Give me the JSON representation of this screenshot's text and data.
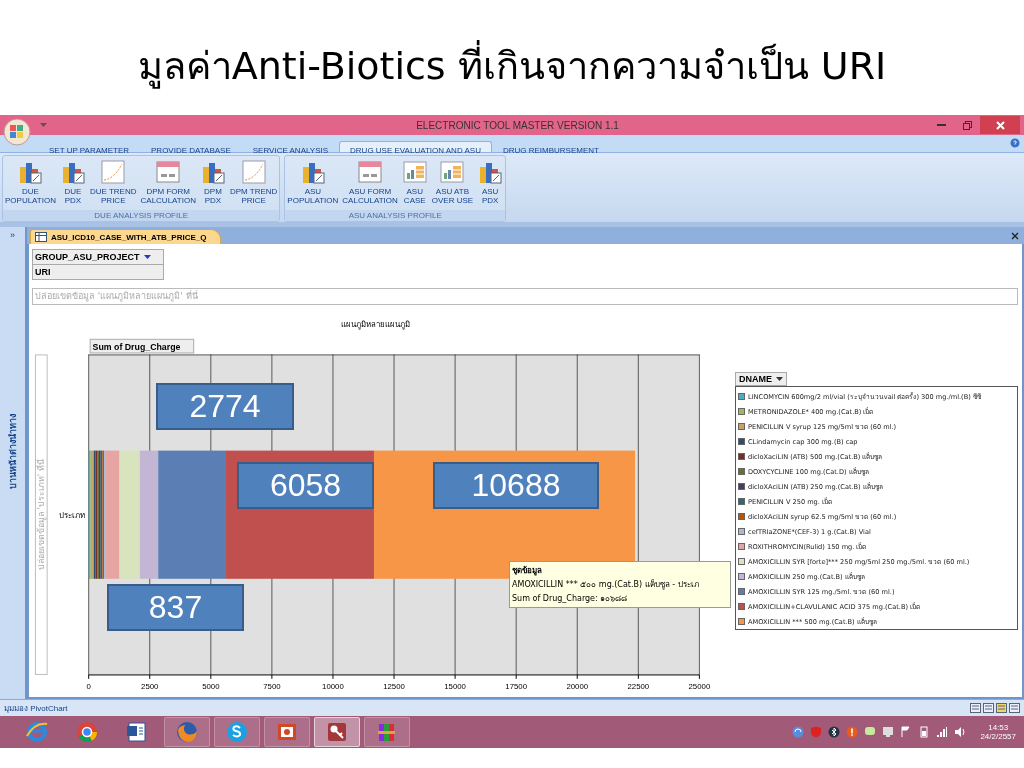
{
  "slide_title": "มูลค่าAnti-Biotics ที่เกินจากความจำเป็น URI",
  "window": {
    "title": "ELECTRONIC TOOL MASTER VERSION 1.1"
  },
  "ribbon_tabs": [
    {
      "label": "SET UP PARAMETER",
      "selected": false
    },
    {
      "label": "PROVIDE DATABASE",
      "selected": false
    },
    {
      "label": "SERVICE ANALYSIS",
      "selected": false
    },
    {
      "label": "DRUG USE EVALUATION AND ASU",
      "selected": true
    },
    {
      "label": "DRUG REIMBURSEMENT",
      "selected": false
    }
  ],
  "ribbon_groups": [
    {
      "label": "DUE ANALYSIS PROFILE",
      "buttons": [
        {
          "kind": "bars",
          "lines": [
            "DUE",
            "POPULATION"
          ]
        },
        {
          "kind": "bars",
          "lines": [
            "DUE",
            "PDX"
          ]
        },
        {
          "kind": "trend",
          "lines": [
            "DUE TREND",
            "PRICE"
          ]
        },
        {
          "kind": "form",
          "lines": [
            "DPM FORM",
            "CALCULATION"
          ]
        },
        {
          "kind": "bars",
          "lines": [
            "DPM",
            "PDX"
          ]
        },
        {
          "kind": "trend",
          "lines": [
            "DPM TREND",
            "PRICE"
          ]
        }
      ]
    },
    {
      "label": "ASU ANALYSIS PROFILE",
      "buttons": [
        {
          "kind": "bars",
          "lines": [
            "ASU",
            "POPULATION"
          ]
        },
        {
          "kind": "form",
          "lines": [
            "ASU FORM",
            "CALCULATION"
          ]
        },
        {
          "kind": "case",
          "lines": [
            "ASU",
            "CASE"
          ]
        },
        {
          "kind": "case",
          "lines": [
            "ASU ATB",
            "OVER USE"
          ]
        },
        {
          "kind": "bars",
          "lines": [
            "ASU",
            "PDX"
          ]
        }
      ]
    }
  ],
  "nav_pane": {
    "toggle": "»",
    "label": "บานหน้าต่างนำทาง"
  },
  "document_tab": {
    "title": "ASU_ICD10_CASE_WITH_ATB_PRICE_Q"
  },
  "filter": {
    "field": "GROUP_ASU_PROJECT",
    "value": "URI"
  },
  "chart_drop_zone": "ปล่อยเขตข้อมูล 'แผนภูมิหลายแผนภูมิ' ที่นี่",
  "category_drop_zone": "ปล่อยเขตข้อมูล 'ประเภท' ที่นี่",
  "data_field": "Sum of Drug_Charge",
  "legend_title": "DNAME",
  "chart_data": {
    "type": "bar",
    "orientation": "horizontal",
    "stacked": true,
    "grid": true,
    "legend": "right",
    "title": "แผนภูมิหลายแผนภูมิ",
    "categories": [
      "ประเภท"
    ],
    "xlim": [
      0,
      25000
    ],
    "xticks": [
      0,
      2500,
      5000,
      7500,
      10000,
      12500,
      15000,
      17500,
      20000,
      22500,
      25000
    ],
    "series": [
      {
        "name": "LINCOMYCIN  600mg/2 ml/vial (ระบุจำนวนvail ต่อครั้ง) 300 mg./ml.(B) ซีซี",
        "color": "#4bacc6",
        "values": [
          70
        ]
      },
      {
        "name": "METRONIDAZOLE* 400 mg.(Cat.B) เม็ด",
        "color": "#9bbb59",
        "values": [
          70
        ]
      },
      {
        "name": "PENICILLIN V syrup 125 mg/5ml ขวด (60 ml.)",
        "color": "#c8a060",
        "values": [
          70
        ]
      },
      {
        "name": "CLindamycin cap 300 mg.(B) cap",
        "color": "#2c4d75",
        "values": [
          70
        ]
      },
      {
        "name": "dicloXaciLIN (ATB) 500 mg.(Cat.B) แค็บซูล",
        "color": "#772c2a",
        "values": [
          70
        ]
      },
      {
        "name": "DOXYCYCLINE 100 mg.(Cat.D) แค็บซูล",
        "color": "#5f7530",
        "values": [
          70
        ]
      },
      {
        "name": "dicloXAciLIN (ATB) 250 mg.(Cat.B) แค็บซูล",
        "color": "#4d3b62",
        "values": [
          70
        ]
      },
      {
        "name": "PENICILLIN  V 250 mg. เม็ด",
        "color": "#276a7c",
        "values": [
          70
        ]
      },
      {
        "name": "dicloXAciLIN syrup 62.5 mg/5ml ขวด (60 ml.)",
        "color": "#b65708",
        "values": [
          70
        ]
      },
      {
        "name": "cefTRIaZONE*(CEF-3) 1 g.(Cat.B) Vial",
        "color": "#a9b8d4",
        "values": [
          70
        ]
      },
      {
        "name": "ROXITHROMYCIN(Rulid) 150 mg. เม็ด",
        "color": "#e6a5a3",
        "values": [
          560
        ]
      },
      {
        "name": "AMOXICILLIN SYR [forte]*** 250 mg/5ml 250 mg./5ml. ขวด (60 ml.)",
        "color": "#d7e4bd",
        "values": [
          837
        ]
      },
      {
        "name": "AMOXICILLIN 250 mg.(Cat.B) แค็บซูล",
        "color": "#c3b6d4",
        "values": [
          750
        ]
      },
      {
        "name": "AMOXICILLIN SYR 125 mg./5ml. ขวด (60 ml.)",
        "color": "#5b7fb5",
        "values": [
          2774
        ]
      },
      {
        "name": "AMOXICILLIN+CLAVULANIC ACID 375 mg.(Cat.B) เม็ด",
        "color": "#c0504d",
        "values": [
          6058
        ]
      },
      {
        "name": "AMOXICILLIN *** 500 mg.(Cat.B) แค็บซูล",
        "color": "#f79646",
        "values": [
          10688
        ]
      }
    ]
  },
  "tooltip": {
    "title": "ชุดข้อมูล",
    "lines": [
      "AMOXICILLIN *** ๕๐๐ mg.(Cat.B) แค็บซูล  - ประเภ",
      "Sum of Drug_Charge: ๑๐๖๘๘"
    ]
  },
  "callouts": [
    {
      "text": "2774"
    },
    {
      "text": "6058"
    },
    {
      "text": "10688"
    },
    {
      "text": "837"
    }
  ],
  "status_bar": {
    "text": "มุมมอง PivotChart"
  },
  "taskbar": {
    "apps": [
      {
        "kind": "ie",
        "running": false,
        "selected": false
      },
      {
        "kind": "chrome",
        "running": false,
        "selected": false
      },
      {
        "kind": "word",
        "running": false,
        "selected": false
      },
      {
        "kind": "firefox",
        "running": true,
        "selected": false
      },
      {
        "kind": "skype",
        "running": true,
        "selected": false
      },
      {
        "kind": "powerpoint",
        "running": true,
        "selected": false
      },
      {
        "kind": "access",
        "running": true,
        "selected": true
      },
      {
        "kind": "winrar",
        "running": true,
        "selected": false
      }
    ],
    "time": "14:53",
    "date": "24/2/2557"
  }
}
